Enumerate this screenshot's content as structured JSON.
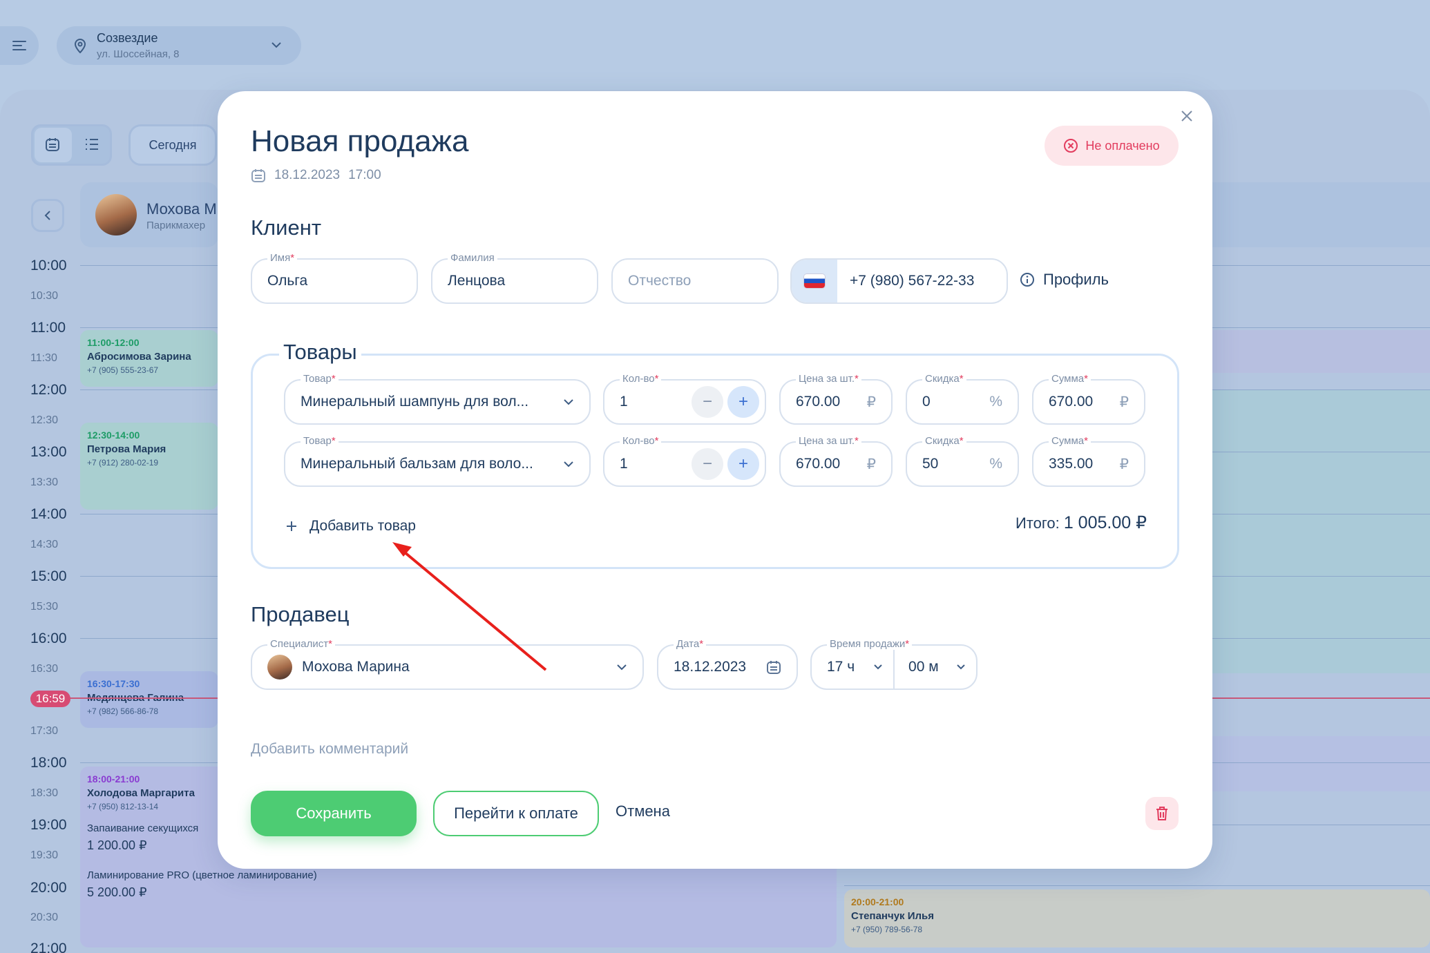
{
  "location": {
    "name": "Созвездие",
    "address": "ул. Шоссейная, 8"
  },
  "toolbar": {
    "today_label": "Сегодня"
  },
  "staff": {
    "name": "Мохова М",
    "role": "Парикмахер"
  },
  "timeline": {
    "labels": [
      "10:00",
      "10:30",
      "11:00",
      "11:30",
      "12:00",
      "12:30",
      "13:00",
      "13:30",
      "14:00",
      "14:30",
      "15:00",
      "15:30",
      "16:00",
      "16:30",
      "17:30",
      "18:00",
      "18:30",
      "19:00",
      "19:30",
      "20:00",
      "20:30",
      "21:00"
    ],
    "now": "16:59"
  },
  "events": [
    {
      "time": "11:00-12:00",
      "name": "Абросимова Зарина",
      "phone": "+7 (905) 555-23-67"
    },
    {
      "time": "12:30-14:00",
      "name": "Петрова Мария",
      "phone": "+7 (912) 280-02-19"
    },
    {
      "time": "16:30-17:30",
      "name": "Медянцева Галина",
      "phone": "+7 (982) 566-86-78"
    },
    {
      "time": "18:00-21:00",
      "name": "Холодова Маргарита",
      "phone": "+7 (950) 812-13-14",
      "service1": "Запаивание секущихся",
      "price1": "1 200.00 ₽",
      "service2": "Ламинирование PRO (цветное ламинирование)",
      "price2": "5 200.00 ₽"
    },
    {
      "time": "20:00-21:00",
      "name": "Степанчук Илья",
      "phone": "+7 (950) 789-56-78"
    }
  ],
  "modal": {
    "title": "Новая продажа",
    "date": "18.12.2023",
    "time": "17:00",
    "status": "Не оплачено",
    "client": {
      "section": "Клиент",
      "first_name_label": "Имя",
      "first_name": "Ольга",
      "last_name_label": "Фамилия",
      "last_name": "Ленцова",
      "patronymic_placeholder": "Отчество",
      "phone": "+7 (980) 567-22-33",
      "profile_label": "Профиль"
    },
    "goods": {
      "section": "Товары",
      "labels": {
        "product": "Товар",
        "qty": "Кол-во",
        "price": "Цена за шт.",
        "discount": "Скидка",
        "sum": "Сумма"
      },
      "rows": [
        {
          "product": "Минеральный шампунь для вол...",
          "qty": "1",
          "price": "670.00",
          "discount": "0",
          "sum": "670.00"
        },
        {
          "product": "Минеральный бальзам для воло...",
          "qty": "1",
          "price": "670.00",
          "discount": "50",
          "sum": "335.00"
        }
      ],
      "currency": "₽",
      "percent": "%",
      "add_label": "Добавить товар",
      "total_label": "Итого:",
      "total_value": "1 005.00 ₽"
    },
    "seller": {
      "section": "Продавец",
      "specialist_label": "Специалист",
      "specialist": "Мохова Марина",
      "date_label": "Дата",
      "date": "18.12.2023",
      "time_label": "Время продажи",
      "hours": "17 ч",
      "minutes": "00 м"
    },
    "comment_label": "Добавить комментарий",
    "save_label": "Сохранить",
    "pay_label": "Перейти к оплате",
    "cancel_label": "Отмена"
  },
  "colors": {
    "accent_green": "#4dcc73",
    "danger": "#e23c5e",
    "arrow": "#e8201c"
  }
}
